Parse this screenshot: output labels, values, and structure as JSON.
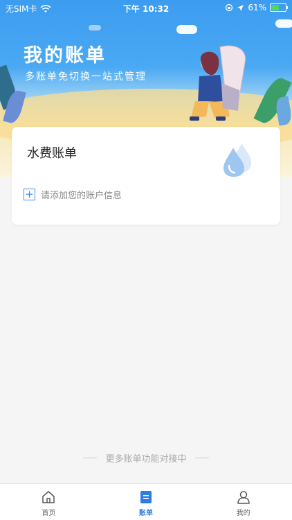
{
  "status_bar": {
    "carrier": "无SIM卡",
    "time": "下午 10:32",
    "battery_percent": "61%",
    "battery_level": 0.61
  },
  "header": {
    "title": "我的账单",
    "subtitle": "多账单免切换一站式管理"
  },
  "bill_card": {
    "title": "水费账单",
    "icon": "water-drop-icon",
    "add_account_label": "请添加您的账户信息"
  },
  "footer_note": "更多账单功能对接中",
  "tabbar": {
    "tabs": [
      {
        "label": "首页",
        "icon": "home-icon",
        "active": false
      },
      {
        "label": "账单",
        "icon": "bill-icon",
        "active": true
      },
      {
        "label": "我的",
        "icon": "user-icon",
        "active": false
      }
    ]
  },
  "colors": {
    "accent": "#2f7de1",
    "header_top": "#3c9cf0",
    "background": "#f5f5f5"
  }
}
